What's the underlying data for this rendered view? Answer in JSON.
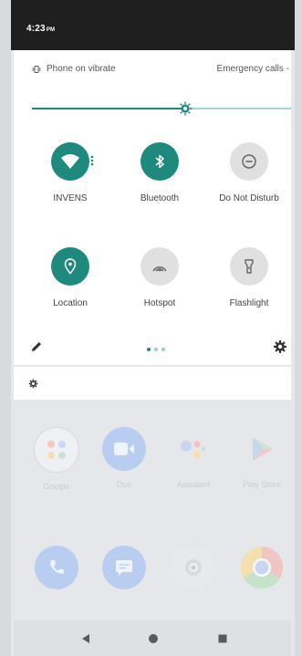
{
  "status": {
    "time": "4:23",
    "ampm": "PM"
  },
  "quick_settings": {
    "ringer_status": "Phone on vibrate",
    "emergency": "Emergency calls -",
    "brightness_level": 0.59,
    "tiles": [
      {
        "label": "INVENS",
        "icon": "wifi-icon",
        "active": true
      },
      {
        "label": "Bluetooth",
        "icon": "bluetooth-icon",
        "active": true
      },
      {
        "label": "Do Not Disturb",
        "icon": "do-not-disturb-icon",
        "active": false
      },
      {
        "label": "Location",
        "icon": "location-icon",
        "active": true
      },
      {
        "label": "Hotspot",
        "icon": "hotspot-icon",
        "active": false
      },
      {
        "label": "Flashlight",
        "icon": "flashlight-icon",
        "active": false
      }
    ],
    "page_indicator": {
      "pages": 3,
      "current": 1
    }
  },
  "home": {
    "apps": [
      {
        "label": "Google"
      },
      {
        "label": "Duo"
      },
      {
        "label": "Assistant"
      },
      {
        "label": "Play Store"
      }
    ],
    "dock": [
      {
        "name": "phone-icon"
      },
      {
        "name": "messages-icon"
      },
      {
        "name": "camera-icon"
      },
      {
        "name": "chrome-icon"
      }
    ]
  },
  "colors": {
    "accent": "#1e8a7d",
    "tile_off": "#e0e0e0"
  }
}
